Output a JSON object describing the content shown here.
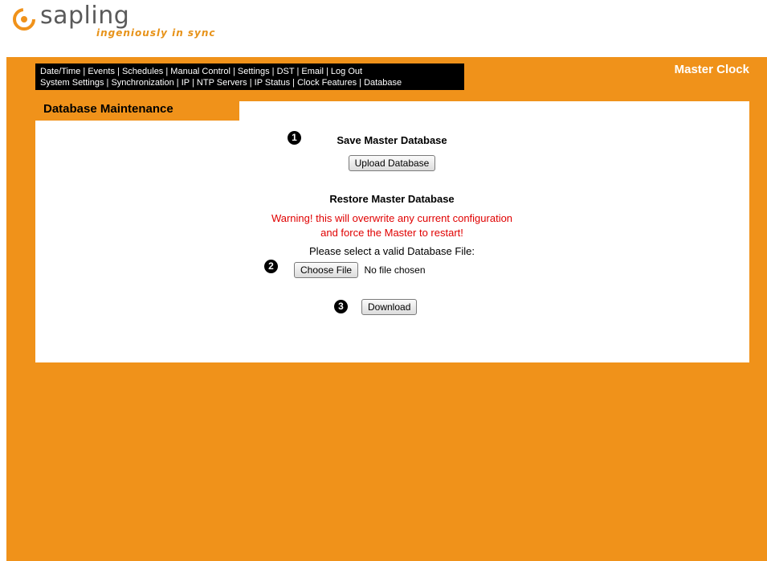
{
  "brand": {
    "name": "sapling",
    "tagline": "ingeniously in sync",
    "accent": "#f0921a"
  },
  "nav": {
    "row1": [
      "Date/Time",
      "Events",
      "Schedules",
      "Manual Control",
      "Settings",
      "DST",
      "Email",
      "Log Out"
    ],
    "row2": [
      "System Settings",
      "Synchronization",
      "IP",
      "NTP Servers",
      "IP Status",
      "Clock Features",
      "Database"
    ]
  },
  "header": {
    "title": "Master Clock"
  },
  "section": {
    "title": "Database Maintenance"
  },
  "save": {
    "step": "1",
    "heading": "Save Master Database",
    "button": "Upload Database"
  },
  "restore": {
    "heading": "Restore Master Database",
    "warning_line1": "Warning! this will overwrite any current configuration",
    "warning_line2": "and force the Master to restart!",
    "prompt": "Please select a valid Database File:",
    "step_file": "2",
    "choose_button": "Choose File",
    "file_status": "No file chosen",
    "step_download": "3",
    "download_button": "Download"
  }
}
